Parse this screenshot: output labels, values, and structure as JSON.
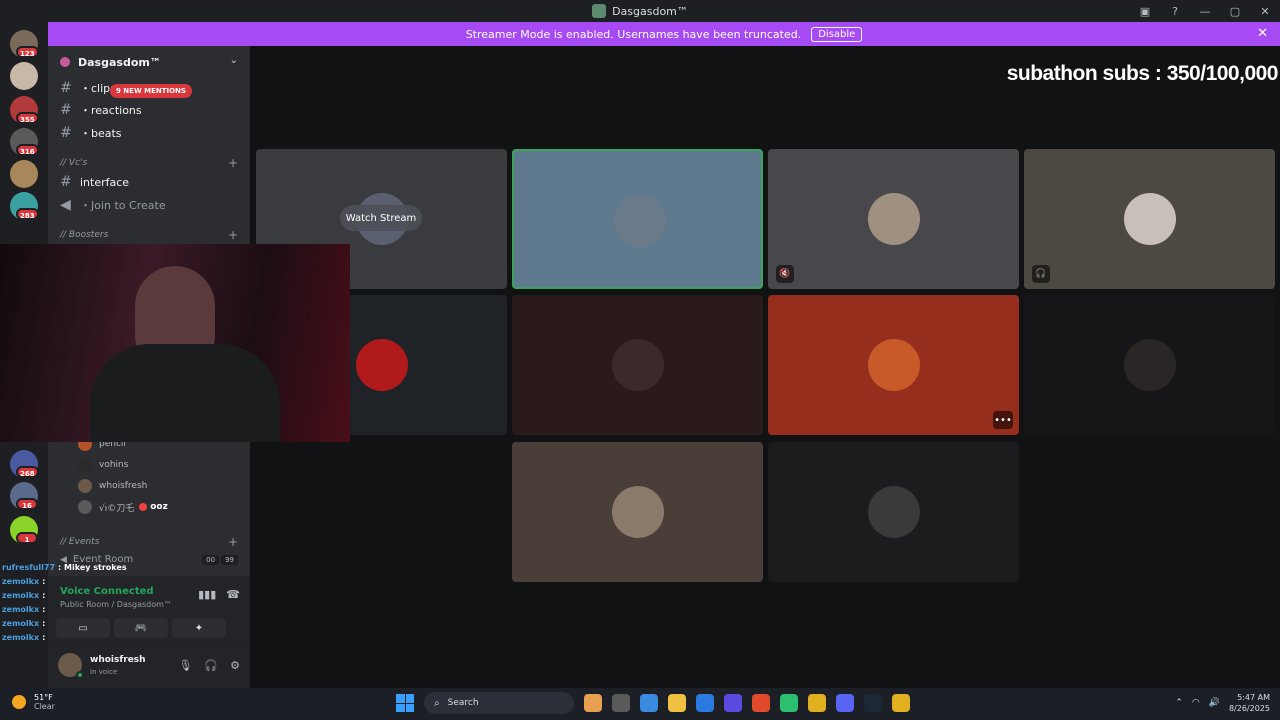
{
  "window": {
    "title": "Dasgasdom™",
    "controls": [
      "—",
      "▢",
      "✕"
    ]
  },
  "banner": {
    "text": "Streamer Mode is enabled. Usernames have been truncated.",
    "disable_label": "Disable",
    "close": "✕"
  },
  "servers": [
    {
      "badge": "123",
      "color": "#7a6a5a"
    },
    {
      "badge": "",
      "color": "#c8b8a8"
    },
    {
      "badge": "355",
      "color": "#b33a3a"
    },
    {
      "badge": "316",
      "color": "#5a5a5a"
    },
    {
      "badge": "",
      "color": "#a8885a"
    },
    {
      "badge": "283",
      "color": "#3aa0a0"
    },
    {
      "badge": "268",
      "color": "#4a5aa0"
    },
    {
      "badge": "16",
      "color": "#5a6a8a"
    },
    {
      "badge": "1",
      "color": "#8ad42a"
    }
  ],
  "guild": {
    "name": "Dasgasdom™",
    "chevron": "⌄"
  },
  "channels": {
    "text": [
      {
        "name": "・clips",
        "hash": "#"
      },
      {
        "name": "・reactions",
        "hash": "#"
      },
      {
        "name": "・beats",
        "hash": "#"
      }
    ],
    "mentions_badge": "9 NEW MENTIONS",
    "vc_category": "// Vc's",
    "interface": "interface",
    "join_to_create": "・Join to Create",
    "boosters_category": "// Boosters",
    "voice_users": [
      {
        "name": "pencil",
        "color": "#b3542a"
      },
      {
        "name": "vohins",
        "color": "#2a2a2a"
      },
      {
        "name": "whoisfresh",
        "color": "#6b5a4a"
      },
      {
        "name": "√ı©刀乇",
        "tag": "ooz",
        "color": "#5a5a5a"
      }
    ],
    "events_category": "// Events",
    "event_room": "Event Room",
    "event_counts": [
      "00",
      "99"
    ]
  },
  "voice_panel": {
    "status": "Voice Connected",
    "room": "Public Room / Dasgasdom™",
    "icons": [
      "waveform-icon",
      "hangup-icon"
    ],
    "buttons": [
      "▭",
      "🎮",
      "✦"
    ]
  },
  "user": {
    "name": "whoisfresh",
    "status": "In voice"
  },
  "chat_overlay": [
    {
      "name": "rufresfull77",
      "msg": ": Mikey strokes"
    },
    {
      "name": "zemolkx",
      "msg": ":"
    },
    {
      "name": "zemolkx",
      "msg": ":"
    },
    {
      "name": "zemolkx",
      "msg": ":"
    },
    {
      "name": "zemolkx",
      "msg": ":"
    },
    {
      "name": "zemolkx",
      "msg": ":"
    }
  ],
  "stage": {
    "subathon": "subathon subs : 350/100,000",
    "watch_stream": "Watch Stream"
  },
  "tiles": [
    {
      "bg": "#3a3b3f",
      "av": "#5a6070",
      "icon": "",
      "highlight": false,
      "more": false
    },
    {
      "bg": "#5f7a8f",
      "av": "#6a7a8a",
      "icon": "",
      "highlight": true,
      "more": false
    },
    {
      "bg": "#48484c",
      "av": "#a09080",
      "icon": "🔇",
      "highlight": false,
      "more": false
    },
    {
      "bg": "#4c4842",
      "av": "#c8c0b8",
      "icon": "🎧",
      "highlight": false,
      "more": false
    },
    {
      "bg": "#1f2226",
      "av": "#b01a1a",
      "icon": "",
      "highlight": false,
      "more": false
    },
    {
      "bg": "#2a1a1a",
      "av": "#3a2a2a",
      "icon": "",
      "highlight": false,
      "more": false
    },
    {
      "bg": "#962e1e",
      "av": "#c85a2a",
      "icon": "",
      "highlight": false,
      "more": true
    },
    {
      "bg": "#161618",
      "av": "#2a2626",
      "icon": "",
      "highlight": false,
      "more": false
    },
    {
      "bg": "#4a3e38",
      "av": "#8a7a6a",
      "icon": "",
      "highlight": false,
      "more": false
    },
    {
      "bg": "#1c1c1e",
      "av": "#3a3a3a",
      "icon": "",
      "highlight": false,
      "more": false
    }
  ],
  "taskbar": {
    "weather_temp": "51°F",
    "weather_desc": "Clear",
    "search_placeholder": "Search",
    "time": "5:47 AM",
    "date": "8/26/2025",
    "app_colors": [
      "#e8a050",
      "#5a5a5a",
      "#3a8ae0",
      "#f0c040",
      "#2a7ae0",
      "#5a4ae0",
      "#e04a2a",
      "#2ac070",
      "#e0b020",
      "#5865f2",
      "#1b2838",
      "#e0b020"
    ]
  }
}
